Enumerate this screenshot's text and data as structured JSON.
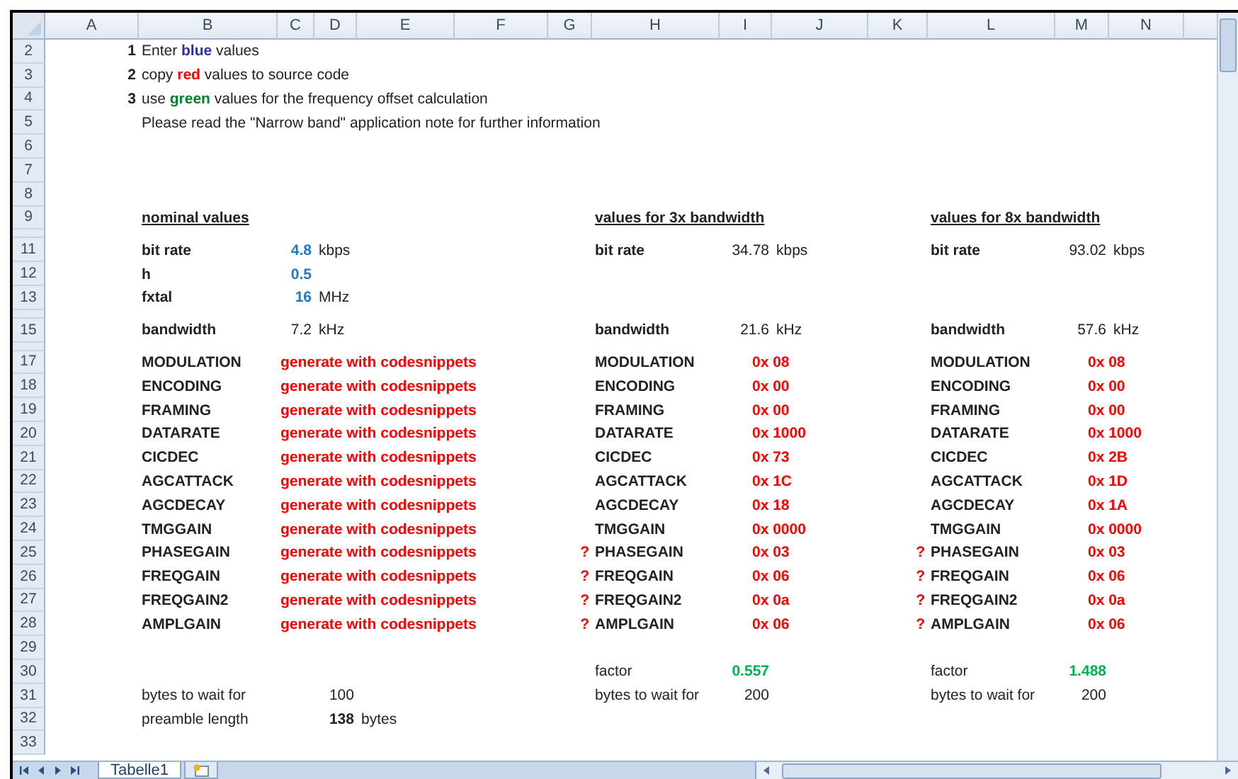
{
  "column_headers": [
    "A",
    "B",
    "C",
    "D",
    "E",
    "F",
    "G",
    "H",
    "I",
    "J",
    "K",
    "L",
    "M",
    "N"
  ],
  "rows": [
    {
      "number": "2",
      "collapsed": false,
      "cells": {
        "A": {
          "kind": "step",
          "text": "1"
        },
        "B": {
          "kind": "sentence",
          "segments": [
            {
              "text": "Enter ",
              "kind": "plain"
            },
            {
              "text": "blue",
              "kind": "blue"
            },
            {
              "text": " values",
              "kind": "plain"
            }
          ]
        }
      }
    },
    {
      "number": "3",
      "collapsed": false,
      "cells": {
        "A": {
          "kind": "step",
          "text": "2"
        },
        "B": {
          "kind": "sentence",
          "segments": [
            {
              "text": "copy ",
              "kind": "plain"
            },
            {
              "text": "red",
              "kind": "red"
            },
            {
              "text": " values to source code",
              "kind": "plain"
            }
          ]
        }
      }
    },
    {
      "number": "4",
      "collapsed": false,
      "cells": {
        "A": {
          "kind": "step",
          "text": "3"
        },
        "B": {
          "kind": "sentence",
          "segments": [
            {
              "text": "use ",
              "kind": "plain"
            },
            {
              "text": "green",
              "kind": "green"
            },
            {
              "text": " values for the frequency offset calculation",
              "kind": "plain"
            }
          ]
        }
      }
    },
    {
      "number": "5",
      "collapsed": false,
      "cells": {
        "B": {
          "kind": "note",
          "text": "Please read the \"Narrow band\" application note for further information"
        }
      }
    },
    {
      "number": "6",
      "collapsed": false
    },
    {
      "number": "7",
      "collapsed": false
    },
    {
      "number": "8",
      "collapsed": false
    },
    {
      "number": "9",
      "collapsed": false,
      "cells": {
        "B": {
          "kind": "heading",
          "text": "nominal values"
        },
        "H": {
          "kind": "heading",
          "text": "values for 3x bandwidth"
        },
        "L": {
          "kind": "heading",
          "text": "values for 8x bandwidth"
        }
      }
    },
    {
      "collapsed": true
    },
    {
      "number": "11",
      "collapsed": false,
      "cells": {
        "B": {
          "kind": "label",
          "text": "bit rate"
        },
        "C": {
          "kind": "input",
          "text": "4.8"
        },
        "D": {
          "kind": "unit",
          "text": "kbps"
        },
        "H": {
          "kind": "label",
          "text": "bit rate"
        },
        "I": {
          "kind": "value",
          "text": "34.78"
        },
        "J": {
          "kind": "unit",
          "text": "kbps"
        },
        "L": {
          "kind": "label",
          "text": "bit rate"
        },
        "M": {
          "kind": "value",
          "text": "93.02"
        },
        "N": {
          "kind": "unit",
          "text": "kbps"
        }
      }
    },
    {
      "number": "12",
      "collapsed": false,
      "cells": {
        "B": {
          "kind": "label",
          "text": "h"
        },
        "C": {
          "kind": "input",
          "text": "0.5"
        }
      }
    },
    {
      "number": "13",
      "collapsed": false,
      "cells": {
        "B": {
          "kind": "label",
          "text": "fxtal"
        },
        "C": {
          "kind": "input",
          "text": "16"
        },
        "D": {
          "kind": "unit",
          "text": "MHz"
        }
      }
    },
    {
      "collapsed": true
    },
    {
      "number": "15",
      "collapsed": false,
      "cells": {
        "B": {
          "kind": "label",
          "text": "bandwidth"
        },
        "C": {
          "kind": "value",
          "text": "7.2"
        },
        "D": {
          "kind": "unit",
          "text": "kHz"
        },
        "H": {
          "kind": "label",
          "text": "bandwidth"
        },
        "I": {
          "kind": "value",
          "text": "21.6"
        },
        "J": {
          "kind": "unit",
          "text": "kHz"
        },
        "L": {
          "kind": "label",
          "text": "bandwidth"
        },
        "M": {
          "kind": "value",
          "text": "57.6"
        },
        "N": {
          "kind": "unit",
          "text": "kHz"
        }
      }
    },
    {
      "collapsed": true
    },
    {
      "number": "17",
      "collapsed": false,
      "cells": {
        "B": {
          "kind": "label",
          "text": "MODULATION"
        },
        "C": {
          "kind": "code",
          "text": "generate with codesnippets"
        },
        "H": {
          "kind": "label",
          "text": "MODULATION"
        },
        "I": {
          "kind": "hex",
          "text": "0x 08"
        },
        "L": {
          "kind": "label",
          "text": "MODULATION"
        },
        "M": {
          "kind": "hex",
          "text": "0x 08"
        }
      }
    },
    {
      "number": "18",
      "collapsed": false,
      "cells": {
        "B": {
          "kind": "label",
          "text": "ENCODING"
        },
        "C": {
          "kind": "code",
          "text": "generate with codesnippets"
        },
        "H": {
          "kind": "label",
          "text": "ENCODING"
        },
        "I": {
          "kind": "hex",
          "text": "0x 00"
        },
        "L": {
          "kind": "label",
          "text": "ENCODING"
        },
        "M": {
          "kind": "hex",
          "text": "0x 00"
        }
      }
    },
    {
      "number": "19",
      "collapsed": false,
      "cells": {
        "B": {
          "kind": "label",
          "text": "FRAMING"
        },
        "C": {
          "kind": "code",
          "text": "generate with codesnippets"
        },
        "H": {
          "kind": "label",
          "text": "FRAMING"
        },
        "I": {
          "kind": "hex",
          "text": "0x 00"
        },
        "L": {
          "kind": "label",
          "text": "FRAMING"
        },
        "M": {
          "kind": "hex",
          "text": "0x 00"
        }
      }
    },
    {
      "number": "20",
      "collapsed": false,
      "cells": {
        "B": {
          "kind": "label",
          "text": "DATARATE"
        },
        "C": {
          "kind": "code",
          "text": "generate with codesnippets"
        },
        "H": {
          "kind": "label",
          "text": "DATARATE"
        },
        "I": {
          "kind": "hex",
          "text": "0x 1000"
        },
        "L": {
          "kind": "label",
          "text": "DATARATE"
        },
        "M": {
          "kind": "hex",
          "text": "0x 1000"
        }
      }
    },
    {
      "number": "21",
      "collapsed": false,
      "cells": {
        "B": {
          "kind": "label",
          "text": "CICDEC"
        },
        "C": {
          "kind": "code",
          "text": "generate with codesnippets"
        },
        "H": {
          "kind": "label",
          "text": "CICDEC"
        },
        "I": {
          "kind": "hex",
          "text": "0x 73"
        },
        "L": {
          "kind": "label",
          "text": "CICDEC"
        },
        "M": {
          "kind": "hex",
          "text": "0x 2B"
        }
      }
    },
    {
      "number": "22",
      "collapsed": false,
      "cells": {
        "B": {
          "kind": "label",
          "text": "AGCATTACK"
        },
        "C": {
          "kind": "code",
          "text": "generate with codesnippets"
        },
        "H": {
          "kind": "label",
          "text": "AGCATTACK"
        },
        "I": {
          "kind": "hex",
          "text": "0x 1C"
        },
        "L": {
          "kind": "label",
          "text": "AGCATTACK"
        },
        "M": {
          "kind": "hex",
          "text": "0x 1D"
        }
      }
    },
    {
      "number": "23",
      "collapsed": false,
      "cells": {
        "B": {
          "kind": "label",
          "text": "AGCDECAY"
        },
        "C": {
          "kind": "code",
          "text": "generate with codesnippets"
        },
        "H": {
          "kind": "label",
          "text": "AGCDECAY"
        },
        "I": {
          "kind": "hex",
          "text": "0x 18"
        },
        "L": {
          "kind": "label",
          "text": "AGCDECAY"
        },
        "M": {
          "kind": "hex",
          "text": "0x 1A"
        }
      }
    },
    {
      "number": "24",
      "collapsed": false,
      "cells": {
        "B": {
          "kind": "label",
          "text": "TMGGAIN"
        },
        "C": {
          "kind": "code",
          "text": "generate with codesnippets"
        },
        "H": {
          "kind": "label",
          "text": "TMGGAIN"
        },
        "I": {
          "kind": "hex",
          "text": "0x 0000"
        },
        "L": {
          "kind": "label",
          "text": "TMGGAIN"
        },
        "M": {
          "kind": "hex",
          "text": "0x 0000"
        }
      }
    },
    {
      "number": "25",
      "collapsed": false,
      "cells": {
        "B": {
          "kind": "label",
          "text": "PHASEGAIN"
        },
        "C": {
          "kind": "code",
          "text": "generate with codesnippets"
        },
        "G": {
          "kind": "flag",
          "text": "?"
        },
        "H": {
          "kind": "label",
          "text": "PHASEGAIN"
        },
        "I": {
          "kind": "hex",
          "text": "0x 03"
        },
        "K": {
          "kind": "flag",
          "text": "?"
        },
        "L": {
          "kind": "label",
          "text": "PHASEGAIN"
        },
        "M": {
          "kind": "hex",
          "text": "0x 03"
        }
      }
    },
    {
      "number": "26",
      "collapsed": false,
      "cells": {
        "B": {
          "kind": "label",
          "text": "FREQGAIN"
        },
        "C": {
          "kind": "code",
          "text": "generate with codesnippets"
        },
        "G": {
          "kind": "flag",
          "text": "?"
        },
        "H": {
          "kind": "label",
          "text": "FREQGAIN"
        },
        "I": {
          "kind": "hex",
          "text": "0x 06"
        },
        "K": {
          "kind": "flag",
          "text": "?"
        },
        "L": {
          "kind": "label",
          "text": "FREQGAIN"
        },
        "M": {
          "kind": "hex",
          "text": "0x 06"
        }
      }
    },
    {
      "number": "27",
      "collapsed": false,
      "cells": {
        "B": {
          "kind": "label",
          "text": "FREQGAIN2"
        },
        "C": {
          "kind": "code",
          "text": "generate with codesnippets"
        },
        "G": {
          "kind": "flag",
          "text": "?"
        },
        "H": {
          "kind": "label",
          "text": "FREQGAIN2"
        },
        "I": {
          "kind": "hex",
          "text": "0x 0a"
        },
        "K": {
          "kind": "flag",
          "text": "?"
        },
        "L": {
          "kind": "label",
          "text": "FREQGAIN2"
        },
        "M": {
          "kind": "hex",
          "text": "0x 0a"
        }
      }
    },
    {
      "number": "28",
      "collapsed": false,
      "cells": {
        "B": {
          "kind": "label",
          "text": "AMPLGAIN"
        },
        "C": {
          "kind": "code",
          "text": "generate with codesnippets"
        },
        "G": {
          "kind": "flag",
          "text": "?"
        },
        "H": {
          "kind": "label",
          "text": "AMPLGAIN"
        },
        "I": {
          "kind": "hex",
          "text": "0x 06"
        },
        "K": {
          "kind": "flag",
          "text": "?"
        },
        "L": {
          "kind": "label",
          "text": "AMPLGAIN"
        },
        "M": {
          "kind": "hex",
          "text": "0x 06"
        }
      }
    },
    {
      "number": "29",
      "collapsed": false
    },
    {
      "number": "30",
      "collapsed": false,
      "cells": {
        "H": {
          "kind": "text",
          "text": "factor"
        },
        "I": {
          "kind": "result",
          "text": "0.557"
        },
        "L": {
          "kind": "text",
          "text": "factor"
        },
        "M": {
          "kind": "result",
          "text": "1.488"
        }
      }
    },
    {
      "number": "31",
      "collapsed": false,
      "cells": {
        "B": {
          "kind": "text",
          "text": "bytes to wait for"
        },
        "D": {
          "kind": "value",
          "text": "100"
        },
        "H": {
          "kind": "text",
          "text": "bytes to wait for"
        },
        "I": {
          "kind": "value",
          "text": "200"
        },
        "L": {
          "kind": "text",
          "text": "bytes to wait for"
        },
        "M": {
          "kind": "value",
          "text": "200"
        }
      }
    },
    {
      "number": "32",
      "collapsed": false,
      "cells": {
        "B": {
          "kind": "text",
          "text": "preamble length"
        },
        "D": {
          "kind": "bold-value",
          "text": "138"
        },
        "E": {
          "kind": "unit",
          "text": "bytes"
        }
      }
    },
    {
      "number": "33",
      "collapsed": false
    }
  ],
  "sheet_tabs": [
    {
      "label": "Tabelle1",
      "selected": true
    }
  ]
}
